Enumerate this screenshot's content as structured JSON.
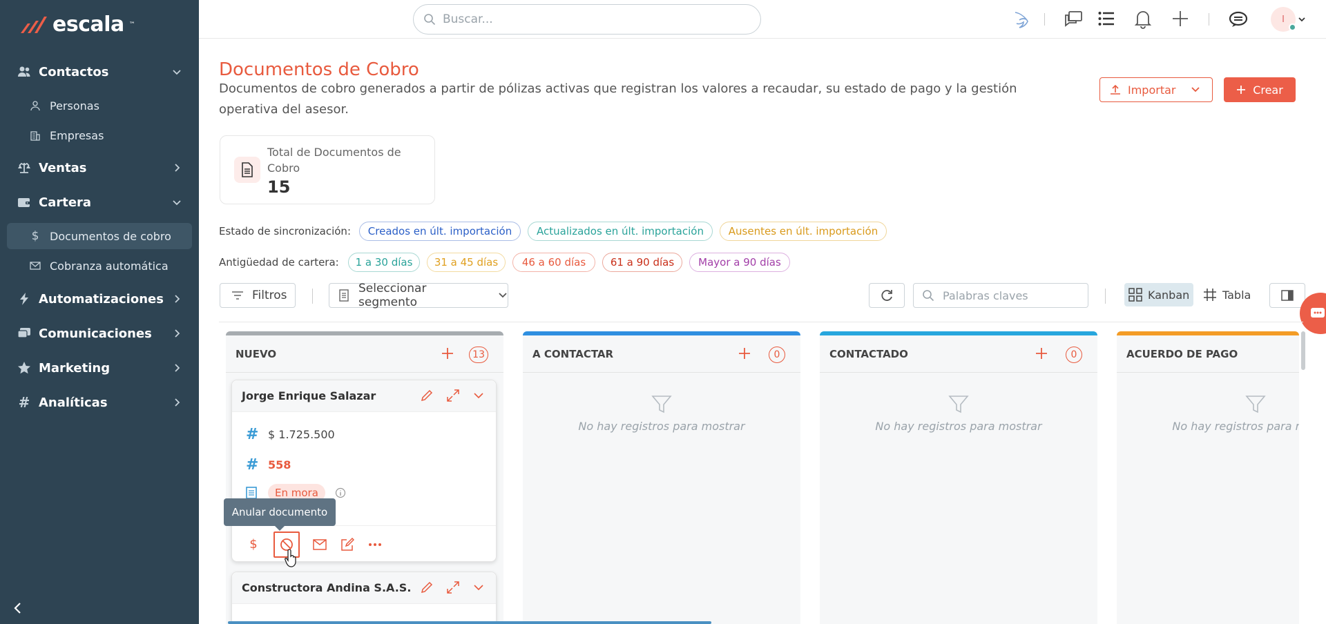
{
  "app": {
    "brand": "escala",
    "brand_tm": "™"
  },
  "sidebar": {
    "items": [
      {
        "label": "Contactos",
        "icon": "users-icon",
        "expanded": true
      },
      {
        "label": "Personas",
        "icon": "person-icon"
      },
      {
        "label": "Empresas",
        "icon": "building-icon"
      },
      {
        "label": "Ventas",
        "icon": "scale-icon",
        "expanded": false
      },
      {
        "label": "Cartera",
        "icon": "wallet-icon",
        "expanded": true
      },
      {
        "label": "Documentos de cobro",
        "icon": "dollar-icon",
        "active": true
      },
      {
        "label": "Cobranza automática",
        "icon": "mail-icon"
      },
      {
        "label": "Automatizaciones",
        "icon": "bolt-icon",
        "expanded": false
      },
      {
        "label": "Comunicaciones",
        "icon": "chat-icon",
        "expanded": false
      },
      {
        "label": "Marketing",
        "icon": "star-icon",
        "expanded": false
      },
      {
        "label": "Analíticas",
        "icon": "hash-icon",
        "expanded": false
      }
    ]
  },
  "topbar": {
    "search_placeholder": "Buscar...",
    "avatar_initial": "I"
  },
  "page": {
    "title": "Documentos de Cobro",
    "description": "Documentos de cobro generados a partir de pólizas activas que registran los valores a recaudar, su estado de pago y la gestión operativa del asesor.",
    "import_label": "Importar",
    "create_label": "Crear"
  },
  "stat": {
    "label": "Total de Documentos de Cobro",
    "value": "15"
  },
  "sync": {
    "label": "Estado de sincronización:",
    "chips": [
      {
        "label": "Creados en últ. importación",
        "color": "#2b5fc7"
      },
      {
        "label": "Actualizados en últ. importación",
        "color": "#2aa39a"
      },
      {
        "label": "Ausentes en últ. importación",
        "color": "#d99a1c"
      }
    ]
  },
  "aging": {
    "label": "Antigüedad de cartera:",
    "chips": [
      {
        "label": "1 a 30 días",
        "color": "#2aa39a"
      },
      {
        "label": "31 a 45 días",
        "color": "#e0a020"
      },
      {
        "label": "46 a 60 días",
        "color": "#e85a3e"
      },
      {
        "label": "61 a 90 días",
        "color": "#c9301a"
      },
      {
        "label": "Mayor a 90 días",
        "color": "#a23ea8"
      }
    ]
  },
  "toolbar": {
    "filters_label": "Filtros",
    "segment_label": "Seleccionar segmento",
    "keywords_placeholder": "Palabras claves",
    "kanban_label": "Kanban",
    "table_label": "Tabla"
  },
  "kanban": {
    "empty_text": "No hay registros para mostrar",
    "columns": [
      {
        "name": "NUEVO",
        "count": "13",
        "color": "#a7acb0"
      },
      {
        "name": "A CONTACTAR",
        "count": "0",
        "color": "#2f8fe0"
      },
      {
        "name": "CONTACTADO",
        "count": "0",
        "color": "#27a6dd"
      },
      {
        "name": "ACUERDO DE PAGO",
        "count": "",
        "color": "#f39c26"
      }
    ],
    "cards": [
      {
        "name": "Jorge Enrique Salazar",
        "amount": "$ 1.725.500",
        "number": "558",
        "status": "En mora"
      },
      {
        "name": "Constructora Andina S.A.S."
      }
    ]
  },
  "tooltip": {
    "text": "Anular documento"
  },
  "colors": {
    "accent": "#e85a3e",
    "sidebar": "#2e4453"
  }
}
